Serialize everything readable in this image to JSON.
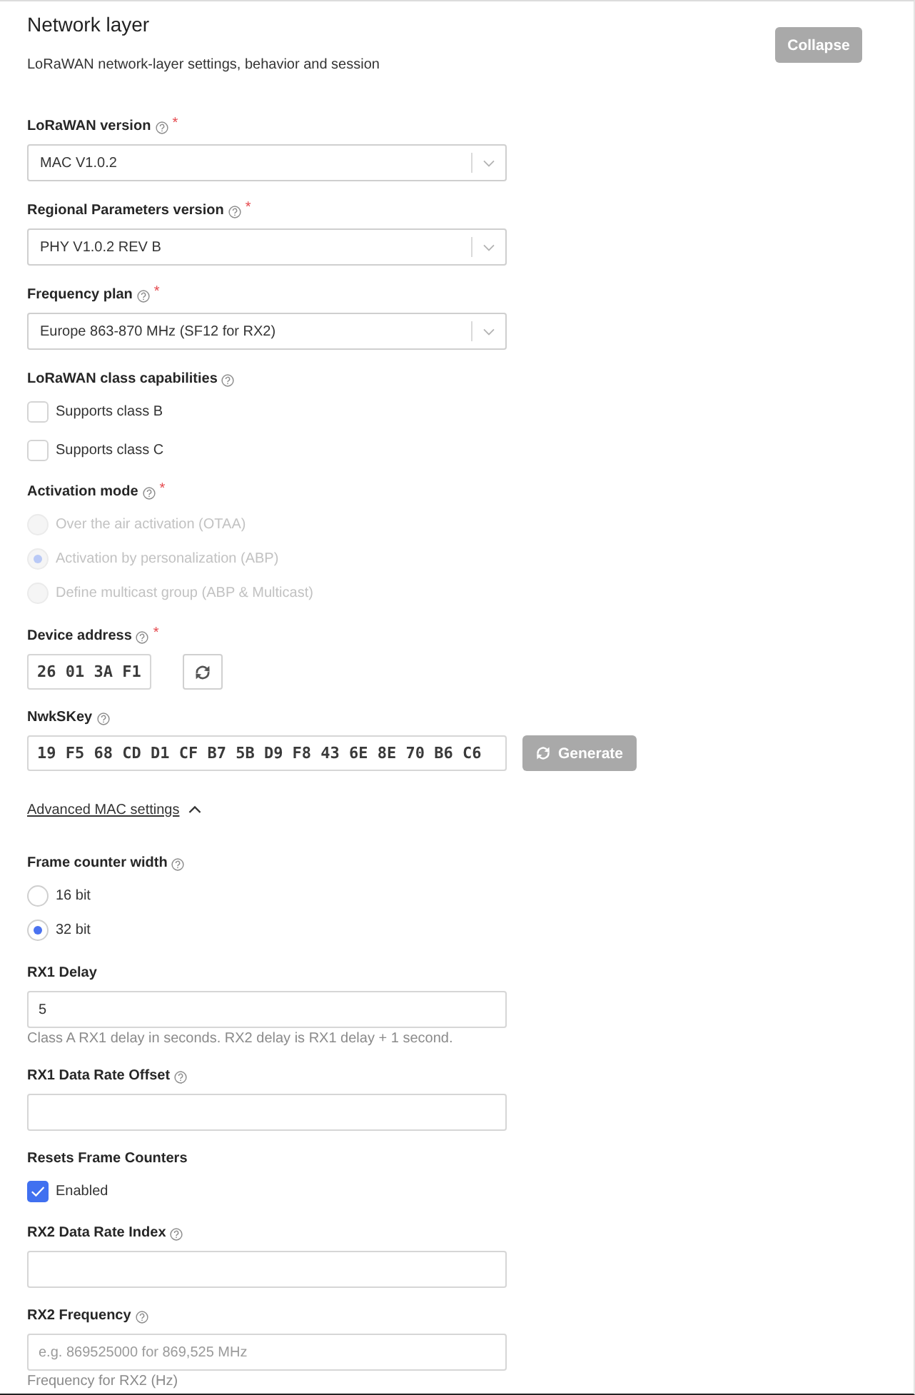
{
  "section": {
    "title": "Network layer",
    "description": "LoRaWAN network-layer settings, behavior and session",
    "collapse_button": {
      "label": "Collapse",
      "disabled": true
    }
  },
  "fields": [
    {
      "kind": "select",
      "label": "LoRaWAN version",
      "help": true,
      "required_mark": "*",
      "value": "MAC V1.0.2"
    },
    {
      "kind": "select",
      "label": "Regional Parameters version",
      "help": true,
      "required_mark": "*",
      "value": "PHY V1.0.2 REV B"
    },
    {
      "kind": "select",
      "label": "Frequency plan",
      "help": true,
      "required_mark": "*",
      "value": "Europe 863-870 MHz (SF12 for RX2)"
    },
    {
      "kind": "checkboxes",
      "label": "LoRaWAN class capabilities",
      "help": true,
      "options": [
        {
          "label": "Supports class B",
          "checked": false
        },
        {
          "label": "Supports class C",
          "checked": false
        }
      ]
    },
    {
      "kind": "radios",
      "label": "Activation mode",
      "help": true,
      "required_mark": "*",
      "disabled": true,
      "options": [
        {
          "label": "Over the air activation (OTAA)",
          "selected": false
        },
        {
          "label": "Activation by personalization (ABP)",
          "selected": true
        },
        {
          "label": "Define multicast group (ABP & Multicast)",
          "selected": false
        }
      ]
    },
    {
      "kind": "key",
      "label": "Device address",
      "help": true,
      "required_mark": "*",
      "value": "26 01 3A F1",
      "action": {
        "kind": "refresh",
        "disabled": false
      }
    },
    {
      "kind": "key",
      "label": "NwkSKey",
      "help": true,
      "value": "19 F5 68 CD D1 CF B7 5B D9 F8 43 6E 8E 70 B6 C6",
      "action": {
        "kind": "generate",
        "label": "Generate",
        "disabled": true
      }
    },
    {
      "kind": "toggle",
      "label": "Advanced MAC settings",
      "expanded": true
    },
    {
      "kind": "radios",
      "label": "Frame counter width",
      "help": true,
      "disabled": false,
      "options": [
        {
          "label": "16 bit",
          "selected": false
        },
        {
          "label": "32 bit",
          "selected": true
        }
      ]
    },
    {
      "kind": "text",
      "label": "RX1 Delay",
      "help": false,
      "value": "5",
      "description": "Class A RX1 delay in seconds. RX2 delay is RX1 delay + 1 second."
    },
    {
      "kind": "text",
      "label": "RX1 Data Rate Offset",
      "help": true
    },
    {
      "kind": "checkboxes",
      "label": "Resets Frame Counters",
      "help": false,
      "options": [
        {
          "label": "Enabled",
          "checked": true
        }
      ]
    },
    {
      "kind": "text",
      "label": "RX2 Data Rate Index",
      "help": true
    },
    {
      "kind": "text",
      "label": "RX2 Frequency",
      "help": true,
      "placeholder": "e.g. 869525000 for 869,525 MHz",
      "description": "Frequency for RX2 (Hz)"
    }
  ]
}
